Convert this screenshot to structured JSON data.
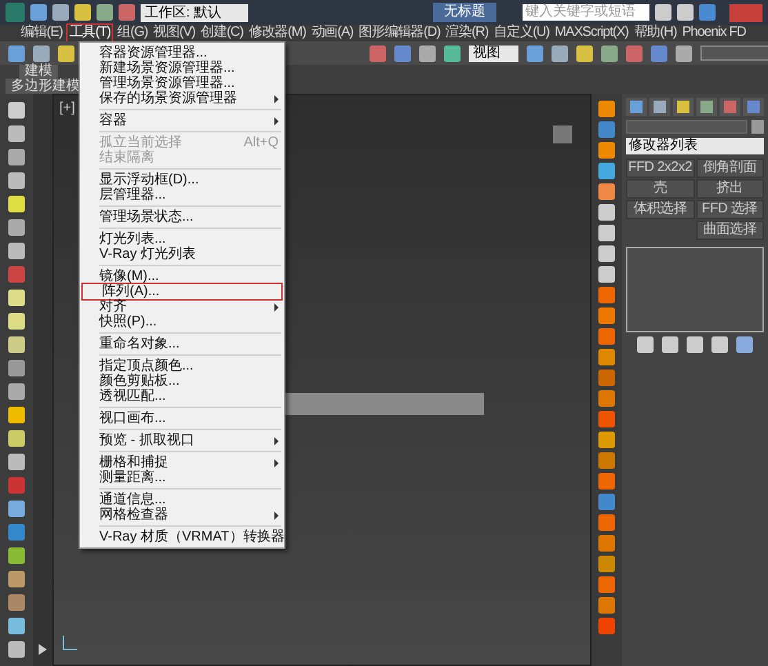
{
  "window": {
    "title": "无标题",
    "workspace": "工作区: 默认",
    "search": {
      "placeholder": "键入关键字或短语"
    }
  },
  "menu_bar": [
    {
      "label": "编辑(E)",
      "selected": false
    },
    {
      "label": "工具(T)",
      "selected": true
    },
    {
      "label": "组(G)",
      "selected": false
    },
    {
      "label": "视图(V)",
      "selected": false
    },
    {
      "label": "创建(C)",
      "selected": false
    },
    {
      "label": "修改器(M)",
      "selected": false
    },
    {
      "label": "动画(A)",
      "selected": false
    },
    {
      "label": "图形编辑器(D)",
      "selected": false
    },
    {
      "label": "渲染(R)",
      "selected": false
    },
    {
      "label": "自定义(U)",
      "selected": false
    },
    {
      "label": "MAXScript(X)",
      "selected": false
    },
    {
      "label": "帮助(H)",
      "selected": false
    },
    {
      "label": "Phoenix FD",
      "selected": false
    }
  ],
  "toolbar": {
    "view_dropdown": "视图"
  },
  "ribbon": {
    "tabs": [
      "建模",
      "多边形建模"
    ]
  },
  "viewport": {
    "label": "[+]"
  },
  "tools_menu": [
    {
      "kind": "item",
      "label": "容器资源管理器...",
      "disabled": false,
      "submenu": false,
      "selected": false
    },
    {
      "kind": "item",
      "label": "新建场景资源管理器...",
      "disabled": false,
      "submenu": false,
      "selected": false
    },
    {
      "kind": "item",
      "label": "管理场景资源管理器...",
      "disabled": false,
      "submenu": false,
      "selected": false
    },
    {
      "kind": "item",
      "label": "保存的场景资源管理器",
      "disabled": false,
      "submenu": true,
      "selected": false
    },
    {
      "kind": "separator"
    },
    {
      "kind": "item",
      "label": "容器",
      "disabled": false,
      "submenu": true,
      "selected": false
    },
    {
      "kind": "separator"
    },
    {
      "kind": "item",
      "label": "孤立当前选择",
      "disabled": true,
      "submenu": false,
      "selected": false,
      "shortcut": "Alt+Q"
    },
    {
      "kind": "item",
      "label": "结束隔离",
      "disabled": true,
      "submenu": false,
      "selected": false
    },
    {
      "kind": "separator"
    },
    {
      "kind": "item",
      "label": "显示浮动框(D)...",
      "disabled": false,
      "submenu": false,
      "selected": false
    },
    {
      "kind": "item",
      "label": "层管理器...",
      "disabled": false,
      "submenu": false,
      "selected": false
    },
    {
      "kind": "separator"
    },
    {
      "kind": "item",
      "label": "管理场景状态...",
      "disabled": false,
      "submenu": false,
      "selected": false
    },
    {
      "kind": "separator"
    },
    {
      "kind": "item",
      "label": "灯光列表...",
      "disabled": false,
      "submenu": false,
      "selected": false
    },
    {
      "kind": "item",
      "label": "V-Ray 灯光列表",
      "disabled": false,
      "submenu": false,
      "selected": false
    },
    {
      "kind": "separator"
    },
    {
      "kind": "item",
      "label": "镜像(M)...",
      "disabled": false,
      "submenu": false,
      "selected": false
    },
    {
      "kind": "item",
      "label": "阵列(A)...",
      "disabled": false,
      "submenu": false,
      "selected": true
    },
    {
      "kind": "item",
      "label": "对齐",
      "disabled": false,
      "submenu": true,
      "selected": false
    },
    {
      "kind": "item",
      "label": "快照(P)...",
      "disabled": false,
      "submenu": false,
      "selected": false
    },
    {
      "kind": "separator"
    },
    {
      "kind": "item",
      "label": "重命名对象...",
      "disabled": false,
      "submenu": false,
      "selected": false
    },
    {
      "kind": "separator"
    },
    {
      "kind": "item",
      "label": "指定顶点颜色...",
      "disabled": false,
      "submenu": false,
      "selected": false
    },
    {
      "kind": "item",
      "label": "颜色剪贴板...",
      "disabled": false,
      "submenu": false,
      "selected": false
    },
    {
      "kind": "item",
      "label": "透视匹配...",
      "disabled": false,
      "submenu": false,
      "selected": false
    },
    {
      "kind": "separator"
    },
    {
      "kind": "item",
      "label": "视口画布...",
      "disabled": false,
      "submenu": false,
      "selected": false
    },
    {
      "kind": "separator"
    },
    {
      "kind": "item",
      "label": "预览 - 抓取视口",
      "disabled": false,
      "submenu": true,
      "selected": false
    },
    {
      "kind": "separator"
    },
    {
      "kind": "item",
      "label": "栅格和捕捉",
      "disabled": false,
      "submenu": true,
      "selected": false
    },
    {
      "kind": "item",
      "label": "测量距离...",
      "disabled": false,
      "submenu": false,
      "selected": false
    },
    {
      "kind": "separator"
    },
    {
      "kind": "item",
      "label": "通道信息...",
      "disabled": false,
      "submenu": false,
      "selected": false
    },
    {
      "kind": "item",
      "label": "网格检查器",
      "disabled": false,
      "submenu": true,
      "selected": false
    },
    {
      "kind": "separator"
    },
    {
      "kind": "item",
      "label": "V-Ray 材质（VRMAT）转换器",
      "disabled": false,
      "submenu": false,
      "selected": false
    }
  ],
  "command_panel": {
    "modifier_list": "修改器列表",
    "modifier_buttons": [
      "FFD 2x2x2",
      "倒角剖面",
      "壳",
      "挤出",
      "体积选择",
      "FFD 选择",
      "曲面选择"
    ]
  }
}
